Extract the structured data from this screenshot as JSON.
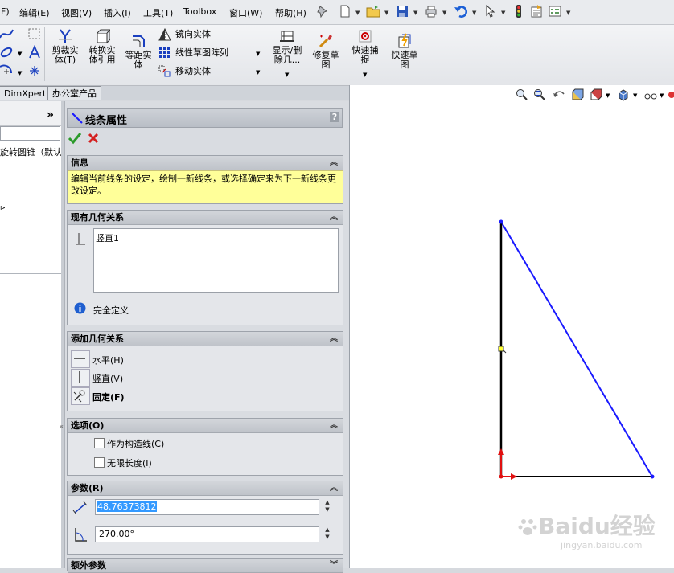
{
  "menu": {
    "items": [
      "F)",
      "编辑(E)",
      "视图(V)",
      "插入(I)",
      "工具(T)",
      "Toolbox",
      "窗口(W)",
      "帮助(H)"
    ]
  },
  "ribbon": {
    "trim": "剪裁实\n体(T)",
    "convert": "转换实\n体引用",
    "offset": "等距实\n体",
    "mirror": "镜向实体",
    "linear_pattern": "线性草图阵列",
    "move": "移动实体",
    "show_delete": "显示/删\n除几...",
    "repair": "修复草\n图",
    "quick_snap": "快速捕\n捉",
    "rapid_sketch": "快速草\n图"
  },
  "tabs": [
    "DimXpert",
    "办公室产品"
  ],
  "tree": {
    "item": "旋转圆锥（默认"
  },
  "pm": {
    "title": "线条属性",
    "help": "?",
    "info": {
      "header": "信息",
      "text": "编辑当前线条的设定，绘制一新线条，或选择确定来为下一新线条更改设定。"
    },
    "existing": {
      "header": "现有几何关系",
      "relations": [
        "竖直1"
      ],
      "status": "完全定义"
    },
    "add": {
      "header": "添加几何关系",
      "items": [
        "水平(H)",
        "竖直(V)",
        "固定(F)"
      ]
    },
    "options": {
      "header": "选项(O)",
      "construction": "作为构造线(C)",
      "infinite": "无限长度(I)"
    },
    "params": {
      "header": "参数(R)",
      "length": "48.76373812",
      "angle": "270.00°"
    },
    "extra": {
      "header": "额外参数"
    }
  },
  "colors": {
    "sketch_line": "#1a1aff",
    "info_bg": "#ffff99",
    "selection": "#3399ff"
  },
  "watermark": {
    "logo": "Baidu经验",
    "url": "jingyan.baidu.com"
  }
}
